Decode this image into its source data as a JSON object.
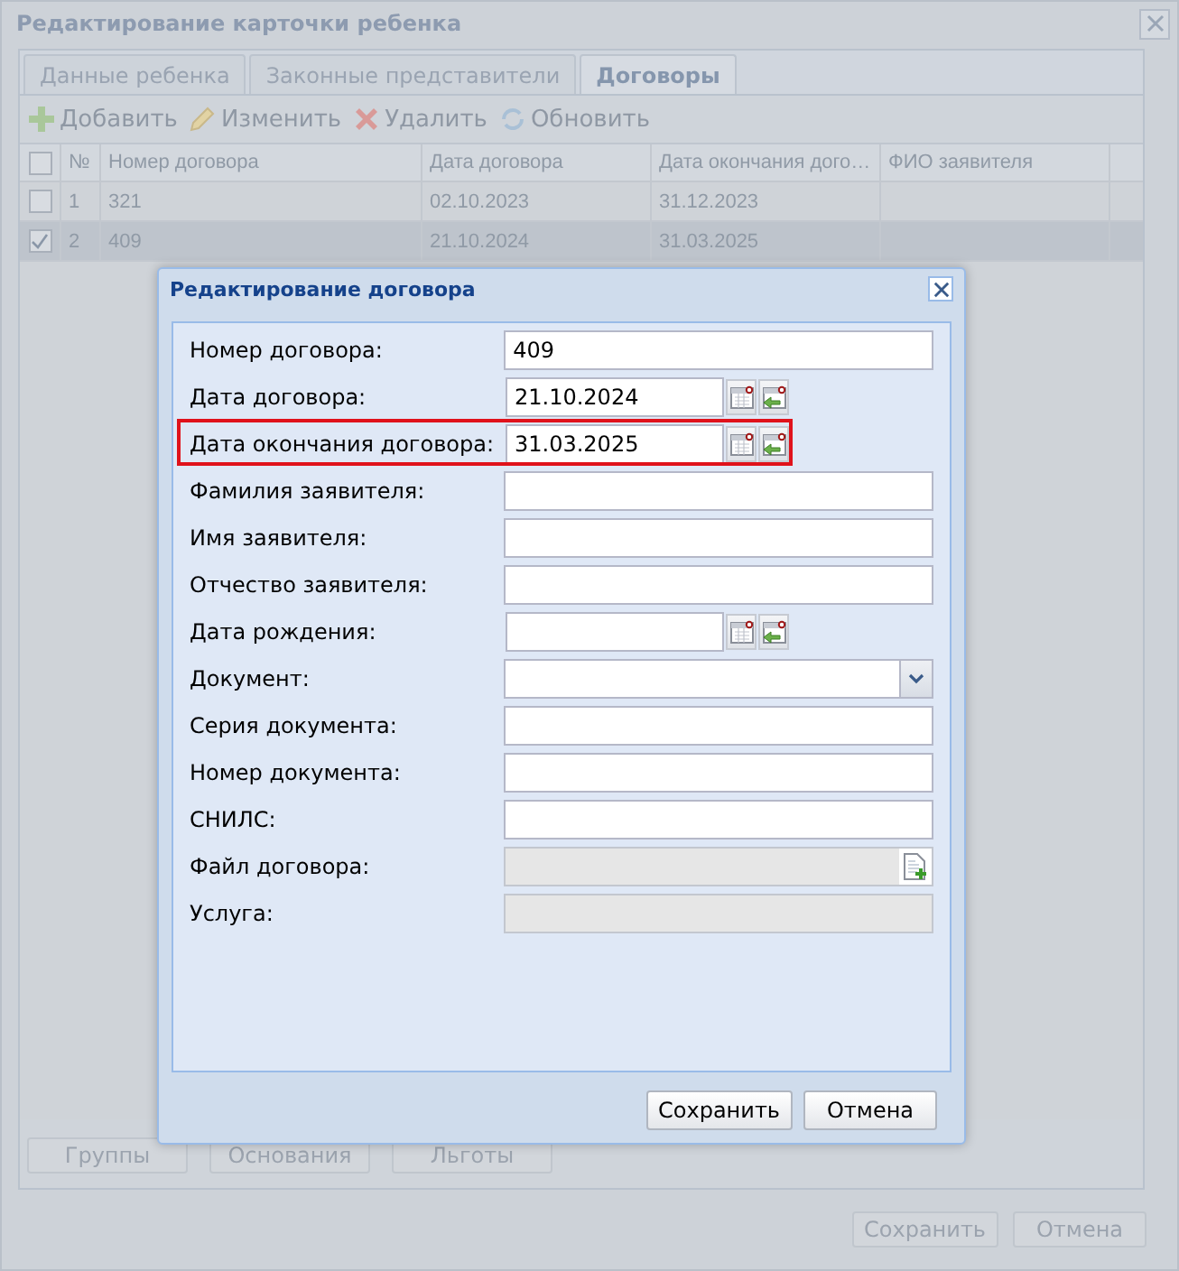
{
  "window": {
    "title": "Редактирование карточки ребенка"
  },
  "tabs": [
    {
      "label": "Данные ребенка",
      "selected": false
    },
    {
      "label": "Законные представители",
      "selected": false
    },
    {
      "label": "Договоры",
      "selected": true
    }
  ],
  "toolbar": [
    {
      "label": "Добавить",
      "kind": "add"
    },
    {
      "label": "Изменить",
      "kind": "edit"
    },
    {
      "label": "Удалить",
      "kind": "delete"
    },
    {
      "label": "Обновить",
      "kind": "refresh"
    }
  ],
  "grid": {
    "all_checked": false,
    "columns": [
      "№",
      "Номер договора",
      "Дата договора",
      "Дата окончания дого…",
      "ФИО заявителя"
    ],
    "rows": [
      {
        "checked": false,
        "selected": false,
        "cells": [
          "1",
          "321",
          "02.10.2023",
          "31.12.2023",
          ""
        ]
      },
      {
        "checked": true,
        "selected": true,
        "cells": [
          "2",
          "409",
          "21.10.2024",
          "31.03.2025",
          ""
        ]
      }
    ]
  },
  "section_buttons": [
    "Группы",
    "Основания",
    "Льготы"
  ],
  "footer_buttons": [
    "Сохранить",
    "Отмена"
  ],
  "dialog": {
    "title": "Редактирование договора",
    "fields": [
      {
        "label": "Номер договора:",
        "kind": "text",
        "value": "409"
      },
      {
        "label": "Дата договора:",
        "kind": "date",
        "value": "21.10.2024"
      },
      {
        "label": "Дата окончания договора:",
        "kind": "date",
        "value": "31.03.2025",
        "highlighted": true
      },
      {
        "label": "Фамилия заявителя:",
        "kind": "text"
      },
      {
        "label": "Имя заявителя:",
        "kind": "text"
      },
      {
        "label": "Отчество заявителя:",
        "kind": "text"
      },
      {
        "label": "Дата рождения:",
        "kind": "date"
      },
      {
        "label": "Документ:",
        "kind": "select"
      },
      {
        "label": "Серия документа:",
        "kind": "text"
      },
      {
        "label": "Номер документа:",
        "kind": "text"
      },
      {
        "label": "СНИЛС:",
        "kind": "text"
      },
      {
        "label": "Файл договора:",
        "kind": "file"
      },
      {
        "label": "Услуга:",
        "kind": "readonly"
      }
    ],
    "buttons": [
      "Сохранить",
      "Отмена"
    ]
  }
}
